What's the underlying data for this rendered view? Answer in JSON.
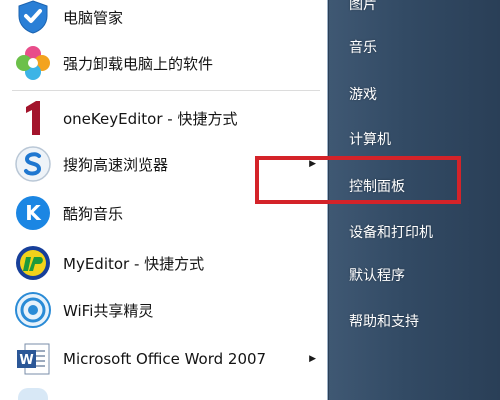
{
  "start_menu": {
    "programs": [
      {
        "label": "电脑管家",
        "icon": "shield-icon",
        "has_submenu": false
      },
      {
        "label": "强力卸载电脑上的软件",
        "icon": "flower-icon",
        "has_submenu": false
      },
      {
        "label": "oneKeyEditor - 快捷方式",
        "icon": "number-one-icon",
        "has_submenu": false
      },
      {
        "label": "搜狗高速浏览器",
        "icon": "sogou-browser-icon",
        "has_submenu": true
      },
      {
        "label": "酷狗音乐",
        "icon": "kugou-icon",
        "has_submenu": false
      },
      {
        "label": "MyEditor - 快捷方式",
        "icon": "myeditor-icon",
        "has_submenu": false
      },
      {
        "label": "WiFi共享精灵",
        "icon": "wifi-icon",
        "has_submenu": false
      },
      {
        "label": "Microsoft Office Word 2007",
        "icon": "word-icon",
        "has_submenu": true
      }
    ],
    "right_items": [
      {
        "label": "图片"
      },
      {
        "label": "音乐"
      },
      {
        "label": "游戏"
      },
      {
        "label": "计算机"
      },
      {
        "label": "控制面板"
      },
      {
        "label": "设备和打印机"
      },
      {
        "label": "默认程序"
      },
      {
        "label": "帮助和支持"
      }
    ],
    "submenu_arrow": "▶"
  },
  "colors": {
    "highlight": "#d42329",
    "right_pane": "#324a64",
    "left_pane": "#ffffff"
  }
}
